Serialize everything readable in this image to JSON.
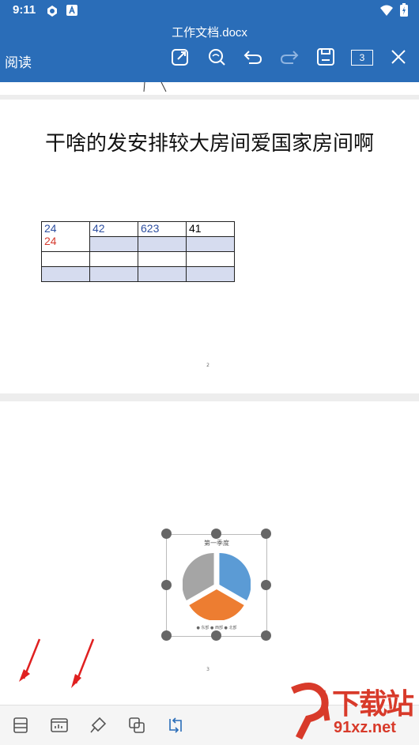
{
  "status_bar": {
    "time": "9:11"
  },
  "title_bar": {
    "document_title": "工作文档.docx",
    "mode_label": "阅读",
    "page_count": "3"
  },
  "page2": {
    "heading": "干啥的发安排较大房间爱国家房间啊",
    "table": [
      [
        "24",
        "42",
        "623",
        "41"
      ],
      [
        "24",
        "",
        "",
        ""
      ],
      [
        "",
        "",
        "",
        ""
      ],
      [
        "",
        "",
        "",
        ""
      ]
    ],
    "page_number": "2"
  },
  "page3": {
    "chart": {
      "title": "第一季度",
      "legend": "● 东部 ● 西部 ● 北部"
    },
    "page_number": "3"
  },
  "chart_data": {
    "type": "pie",
    "title": "第一季度",
    "categories": [
      "东部",
      "西部",
      "北部"
    ],
    "values": [
      1,
      1,
      1
    ],
    "colors": [
      "#5b9bd5",
      "#ed7d31",
      "#a5a5a5"
    ],
    "legend_position": "bottom"
  },
  "watermark": {
    "text": "下载站",
    "url_text": "91xz.net"
  },
  "colors": {
    "toolbar": "#2a6db8",
    "table_shade": "#d6dcef",
    "annotation_arrow": "#e02020"
  }
}
